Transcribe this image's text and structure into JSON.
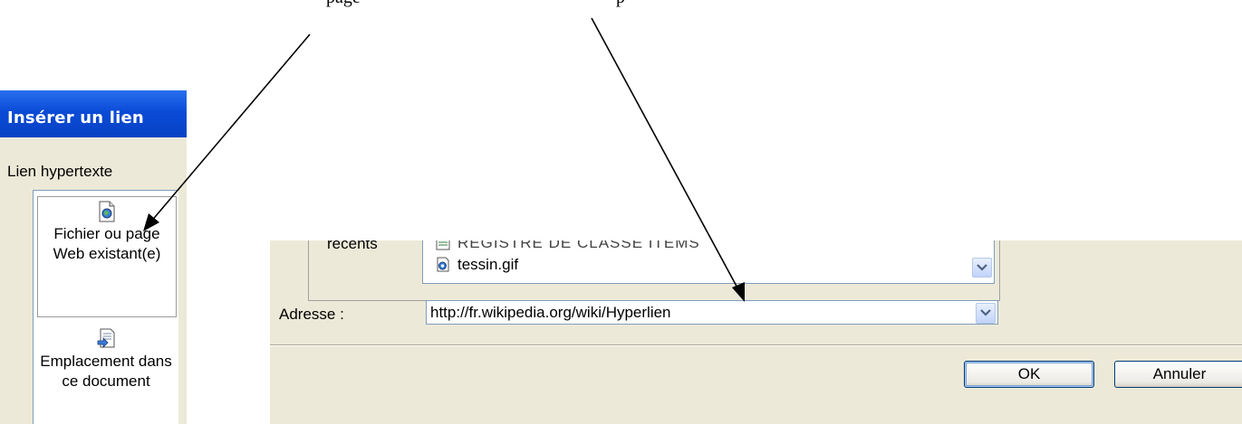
{
  "document": {
    "cut_text_left": "page",
    "cut_text_right": "p"
  },
  "left_dialog": {
    "title": "Insérer un lien",
    "section_label": "Lien hypertexte",
    "places": [
      {
        "label": "Fichier ou page Web existant(e)",
        "icon": "web-file-icon",
        "selected": true
      },
      {
        "label": "Emplacement dans ce document",
        "icon": "document-location-icon",
        "selected": false
      }
    ]
  },
  "main_dialog": {
    "recents_label": "récents",
    "files": [
      {
        "name": "REGISTRE DE CLASSE ITEMS",
        "icon": "file-icon"
      },
      {
        "name": "tessin.gif",
        "icon": "image-file-icon"
      }
    ],
    "address_label": "Adresse :",
    "address_value": "http://fr.wikipedia.org/wiki/Hyperlien",
    "ok_label": "OK",
    "cancel_label": "Annuler"
  },
  "colors": {
    "title_bar": "#0a4bd6",
    "dialog_bg": "#ece9d8",
    "arrow": "#000000"
  }
}
